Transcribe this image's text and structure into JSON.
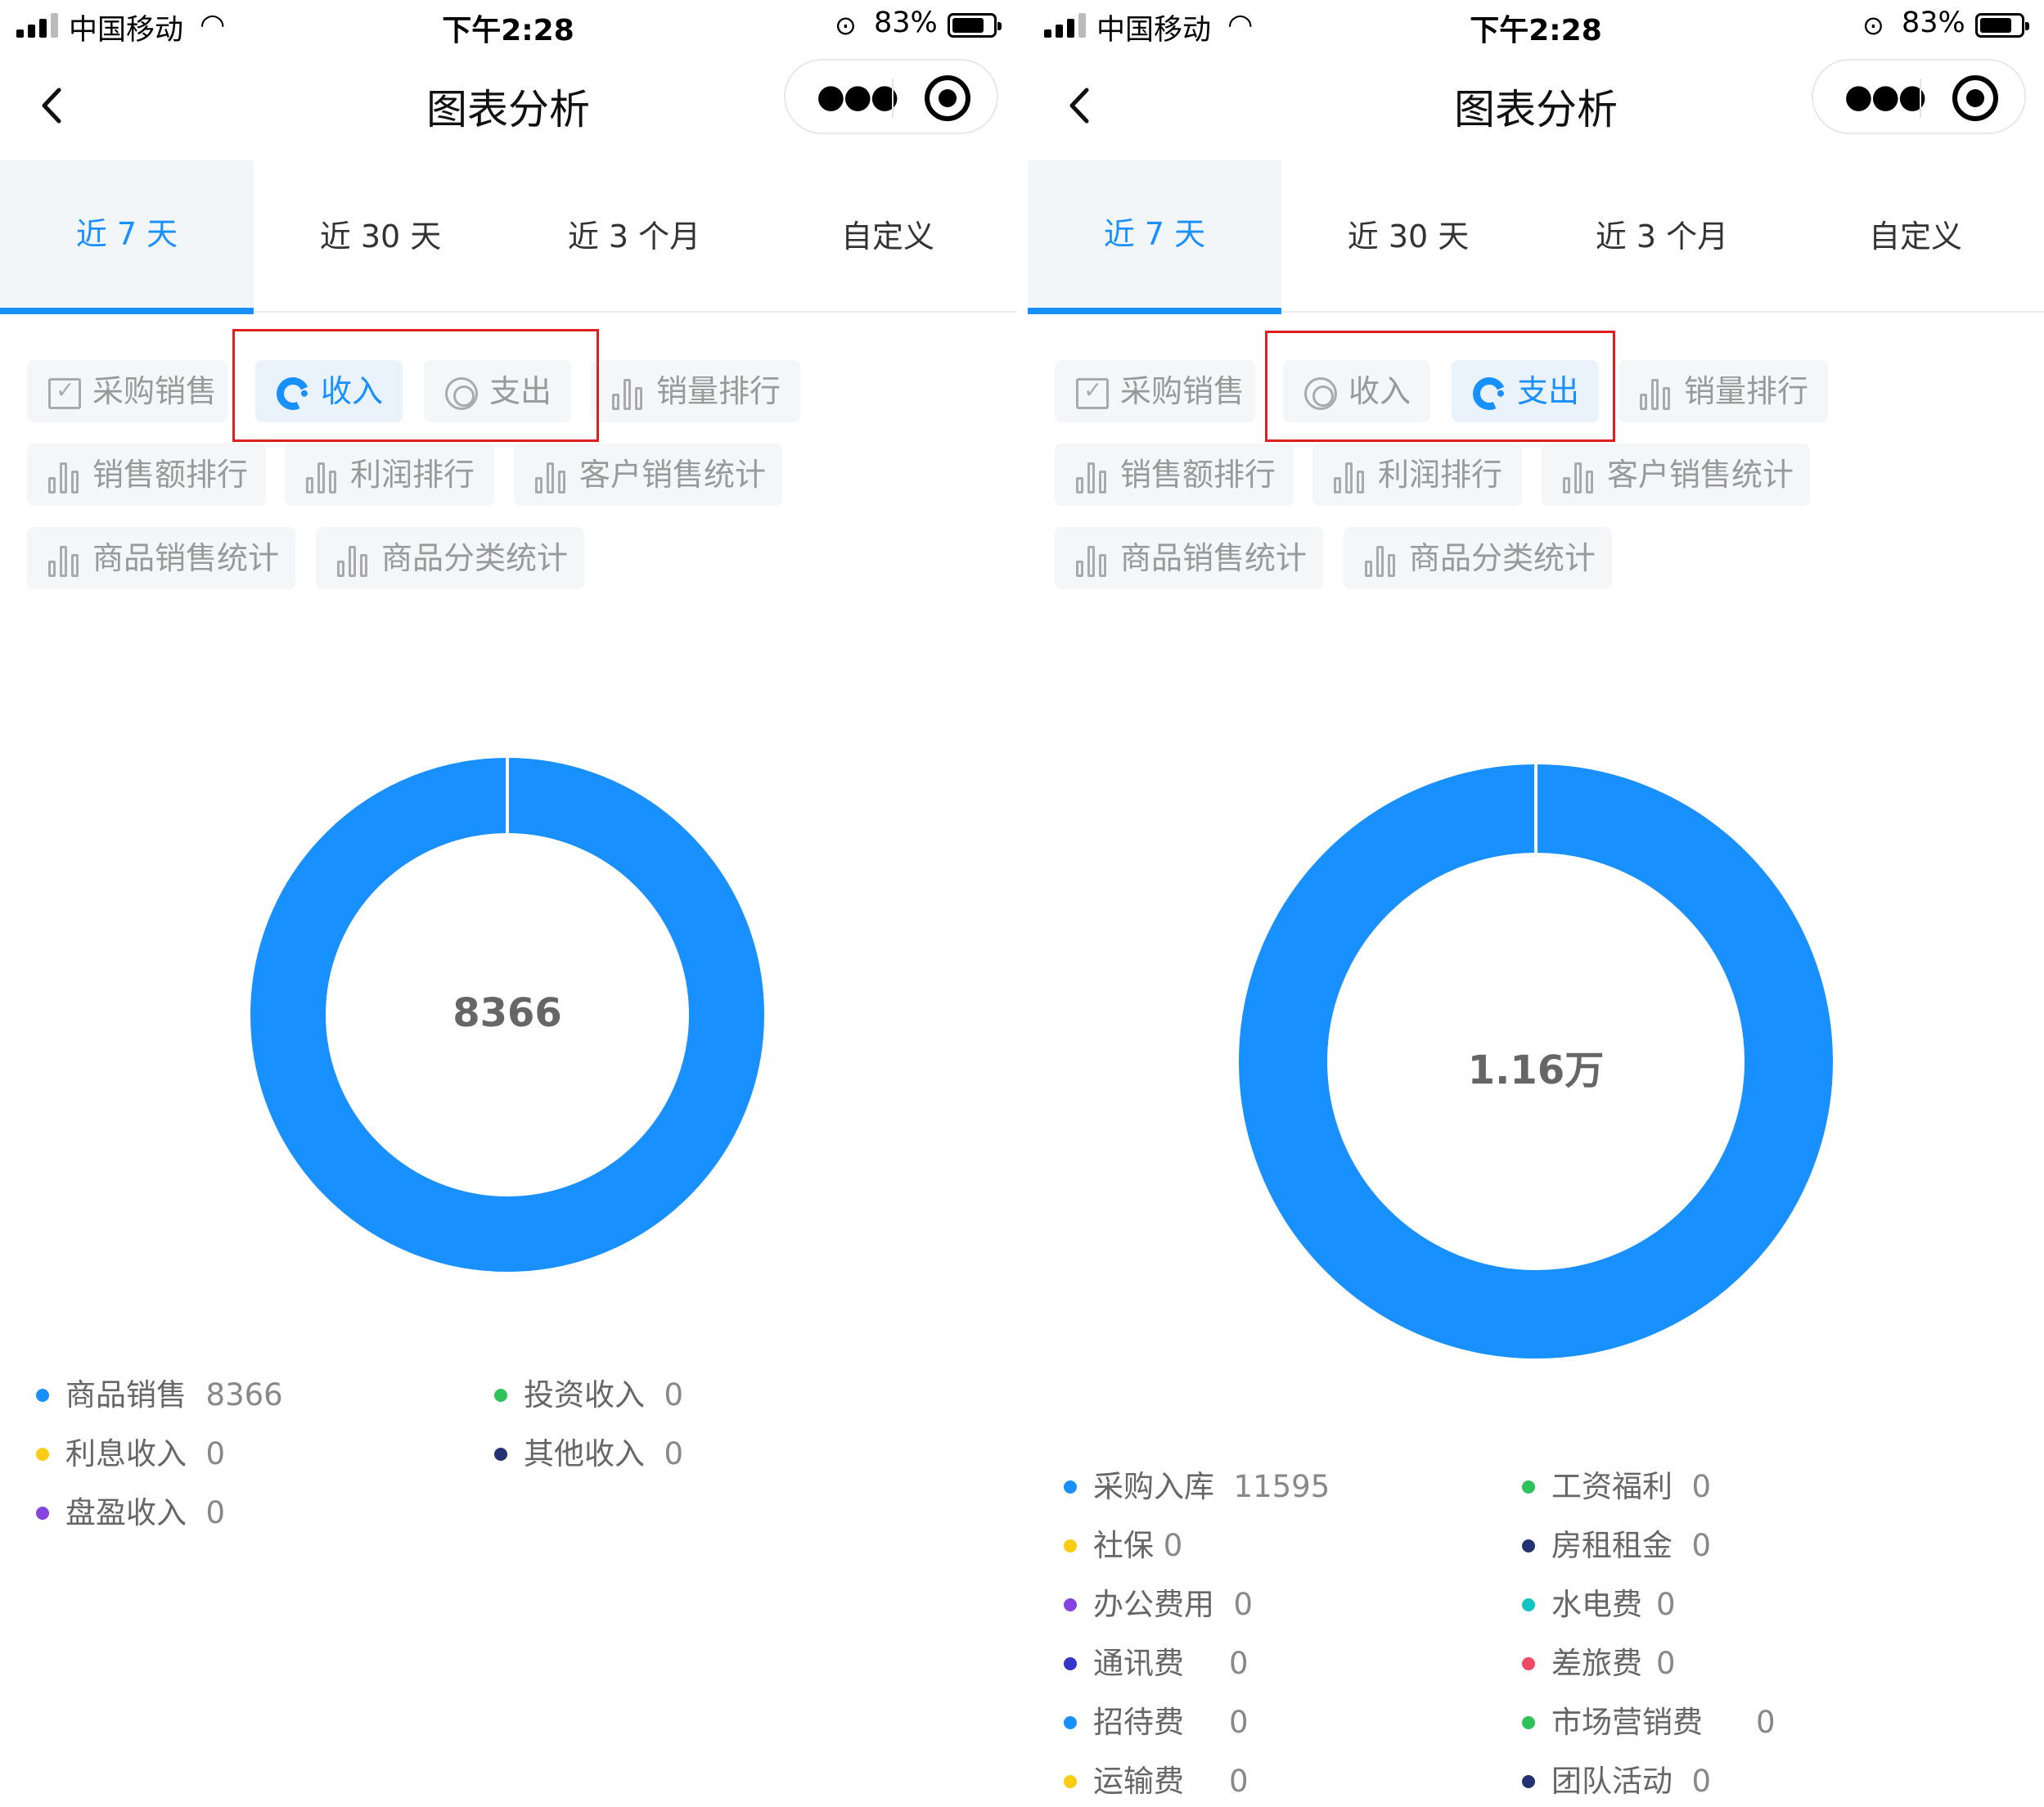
{
  "status_bar": {
    "carrier": "中国移动",
    "time": "下午2:28",
    "battery": "83%"
  },
  "nav": {
    "title": "图表分析"
  },
  "tabs": [
    "近 7 天",
    "近 30 天",
    "近 3 个月",
    "自定义"
  ],
  "chips": [
    "采购销售",
    "收入",
    "支出",
    "销量排行",
    "销售额排行",
    "利润排行",
    "客户销售统计",
    "商品销售统计",
    "商品分类统计"
  ],
  "colors": {
    "accent": "#1890ff",
    "highlight": "#e02020"
  },
  "left": {
    "active_chip": "收入",
    "center_label": "8366",
    "legend": [
      {
        "name": "商品销售",
        "value": "8366",
        "color": "#1890ff"
      },
      {
        "name": "投资收入",
        "value": "0",
        "color": "#2fc25b"
      },
      {
        "name": "利息收入",
        "value": "0",
        "color": "#facc14"
      },
      {
        "name": "其他收入",
        "value": "0",
        "color": "#223273"
      },
      {
        "name": "盘盈收入",
        "value": "0",
        "color": "#8543e0"
      }
    ]
  },
  "right": {
    "active_chip": "支出",
    "center_label": "1.16万",
    "legend": [
      {
        "name": "采购入库",
        "value": "11595",
        "color": "#1890ff"
      },
      {
        "name": "工资福利",
        "value": "0",
        "color": "#2fc25b"
      },
      {
        "name": "社保",
        "value": "0",
        "color": "#facc14"
      },
      {
        "name": "房租租金",
        "value": "0",
        "color": "#223273"
      },
      {
        "name": "办公费用",
        "value": "0",
        "color": "#8543e0"
      },
      {
        "name": "水电费",
        "value": "0",
        "color": "#13c2c2"
      },
      {
        "name": "通讯费",
        "value": "0",
        "color": "#3436c7"
      },
      {
        "name": "差旅费",
        "value": "0",
        "color": "#f04864"
      },
      {
        "name": "招待费",
        "value": "0",
        "color": "#1890ff"
      },
      {
        "name": "市场营销费",
        "value": "0",
        "color": "#2fc25b"
      },
      {
        "name": "运输费",
        "value": "0",
        "color": "#facc14"
      },
      {
        "name": "团队活动",
        "value": "0",
        "color": "#223273"
      }
    ]
  }
}
